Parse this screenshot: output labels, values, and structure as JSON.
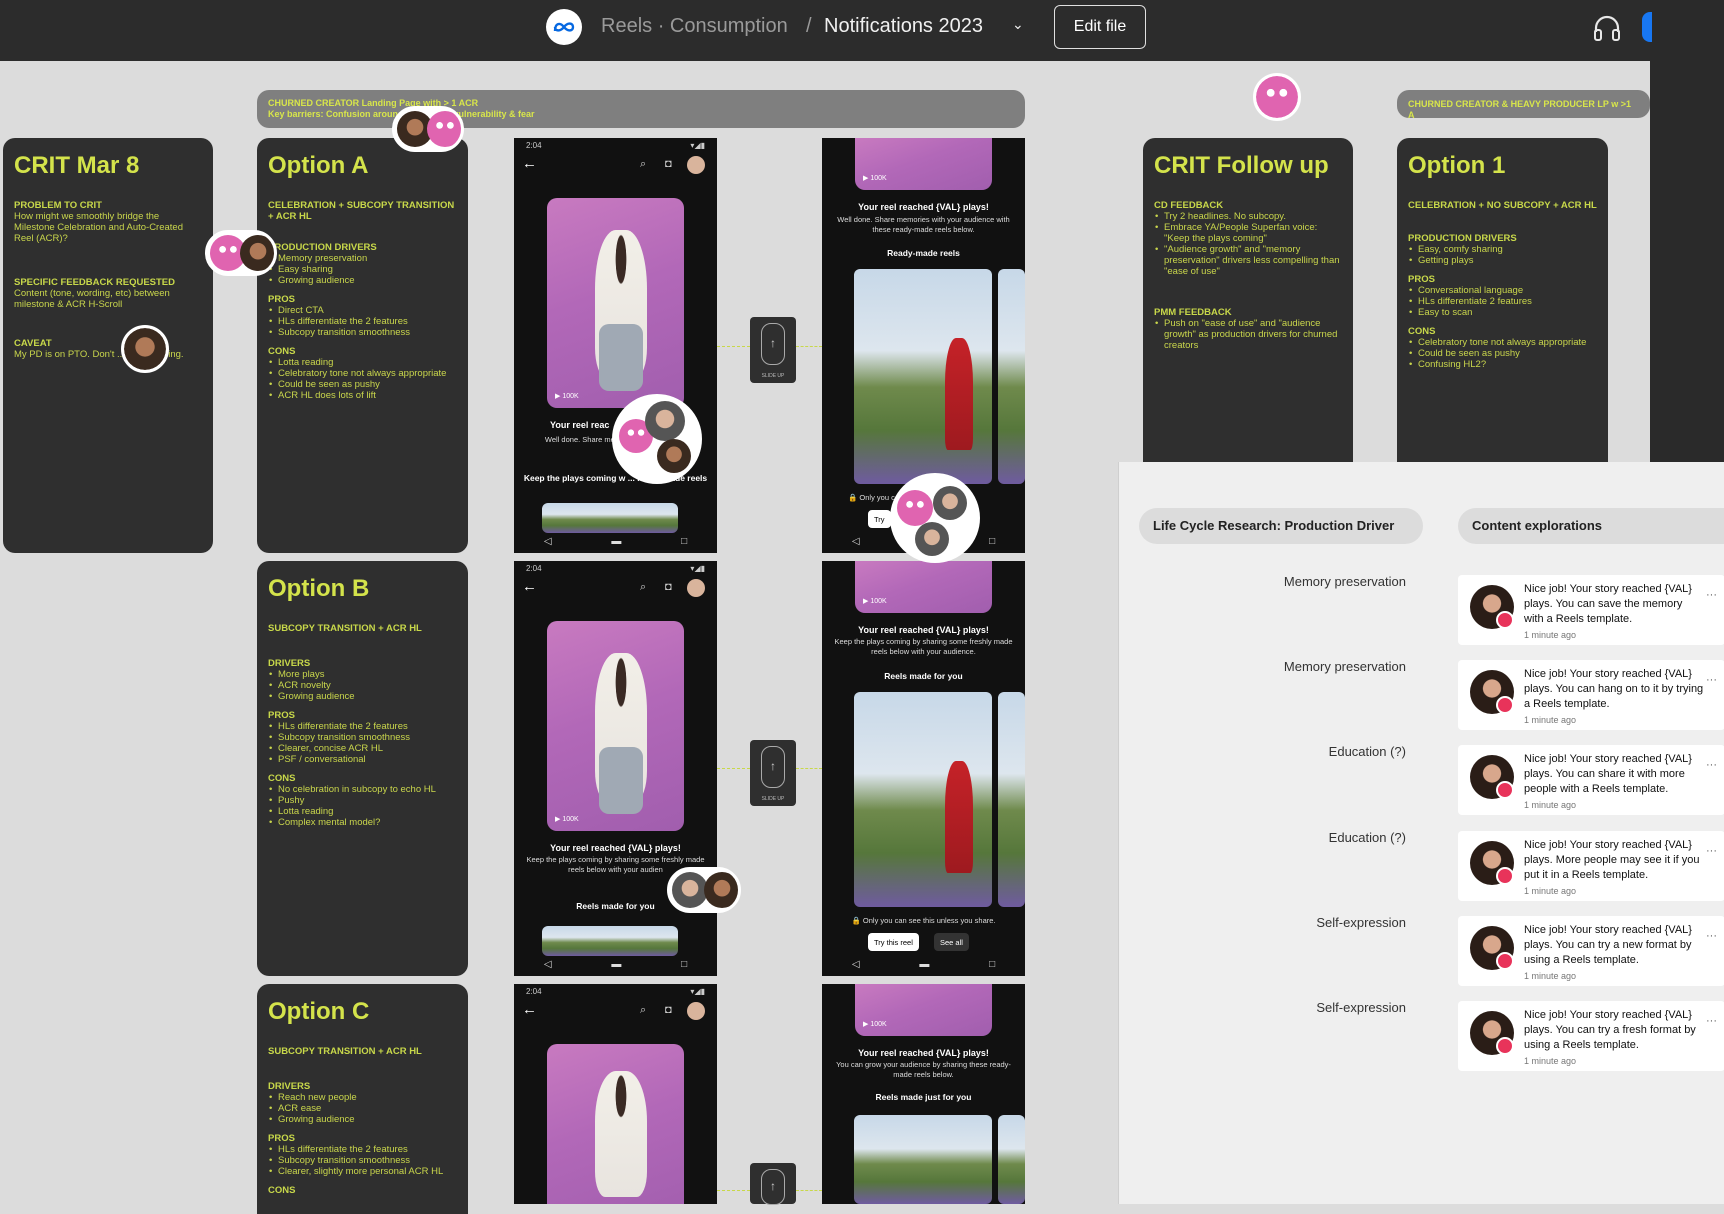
{
  "header": {
    "breadcrumb_parent": "Reels · Consumption",
    "separator": "/",
    "file_name": "Notifications 2023",
    "edit_button": "Edit file"
  },
  "banners": [
    {
      "line1": "CHURNED CREATOR Landing Page with > 1 ACR",
      "line2": "Key barriers: Confusion around the model, vulnerability & fear"
    },
    {
      "line1": "CHURNED CREATOR & HEAVY PRODUCER LP w >1 A",
      "line2": ""
    }
  ],
  "cards": {
    "crit": {
      "title": "CRIT Mar 8",
      "s1": "PROBLEM TO CRIT",
      "t1": "How might we smoothly bridge the Milestone Celebration and Auto-Created Reel (ACR)?",
      "s2": "SPECIFIC FEEDBACK REQUESTED",
      "t2": "Content (tone, wording, etc) between milestone & ACR H-Scroll",
      "s3": "CAVEAT",
      "t3": "My PD is on PTO. Don't ... : my spacing."
    },
    "optA": {
      "title": "Option A",
      "subtitle": "CELEBRATION + SUBCOPY TRANSITION + ACR HL",
      "drivers_h": "PRODUCTION DRIVERS",
      "drivers": [
        "Memory preservation",
        "Easy sharing",
        "Growing audience"
      ],
      "pros_h": "PROS",
      "pros": [
        "Direct CTA",
        "HLs differentiate the 2 features",
        "Subcopy transition smoothness"
      ],
      "cons_h": "CONS",
      "cons": [
        "Lotta reading",
        "Celebratory tone not always appropriate",
        "Could be seen as pushy",
        "ACR HL does lots of lift"
      ]
    },
    "optB": {
      "title": "Option B",
      "subtitle": "SUBCOPY TRANSITION + ACR HL",
      "drivers_h": "DRIVERS",
      "drivers": [
        "More plays",
        "ACR novelty",
        "Growing audience"
      ],
      "pros_h": "PROS",
      "pros": [
        "HLs differentiate the 2 features",
        "Subcopy transition smoothness",
        "Clearer, concise ACR HL",
        "PSF / conversational"
      ],
      "cons_h": "CONS",
      "cons": [
        "No celebration in subcopy to echo HL",
        "Pushy",
        "Lotta reading",
        "Complex mental model?"
      ]
    },
    "optC": {
      "title": "Option C",
      "subtitle": "SUBCOPY TRANSITION + ACR HL",
      "drivers_h": "DRIVERS",
      "drivers": [
        "Reach new people",
        "ACR ease",
        "Growing audience"
      ],
      "pros_h": "PROS",
      "pros": [
        "HLs differentiate the 2 features",
        "Subcopy transition smoothness",
        "Clearer, slightly more personal ACR HL"
      ],
      "cons_h": "CONS"
    },
    "followup": {
      "title": "CRIT Follow up",
      "cd_h": "CD FEEDBACK",
      "cd": [
        "Try 2 headlines. No subcopy.",
        "Embrace YA/People Superfan voice: \"Keep the plays coming\"",
        "\"Audience growth\" and \"memory preservation\" drivers less compelling than \"ease of use\""
      ],
      "pmm_h": "PMM FEEDBACK",
      "pmm": [
        "Push on \"ease of use\" and \"audience growth\" as production drivers for churned creators"
      ]
    },
    "opt1": {
      "title": "Option 1",
      "subtitle": "CELEBRATION + NO SUBCOPY + ACR HL",
      "drivers_h": "PRODUCTION DRIVERS",
      "drivers": [
        "Easy, comfy sharing",
        "Getting plays"
      ],
      "pros_h": "PROS",
      "pros": [
        "Conversational language",
        "HLs differentiate 2 features",
        "Easy to scan"
      ],
      "cons_h": "CONS",
      "cons": [
        "Celebratory tone not always appropriate",
        "Could be seen as pushy",
        "Confusing HL2?"
      ]
    }
  },
  "phones": {
    "time": "2:04",
    "views": "▶ 100K",
    "slide_up": "SLIDE UP",
    "a_left_caption": "Your reel reac",
    "a_left_sub": "Well done. Share mem ... with these ready",
    "a_left_bottom": "Keep the plays coming w ... ready-made reels",
    "a_right_caption": "Your reel reached {VAL} plays!",
    "a_right_sub": "Well done. Share memories with your audience with these ready-made reels below.",
    "a_right_section": "Ready-made reels",
    "a_right_lock": "🔒 Only you c ... share.",
    "a_right_try": "Try",
    "b_left_caption": "Your reel reached {VAL} plays!",
    "b_left_sub": "Keep the plays coming by sharing some freshly made reels below with your audien",
    "b_left_section": "Reels made for you",
    "b_right_caption": "Your reel reached {VAL} plays!",
    "b_right_sub": "Keep the plays coming by sharing some freshly made reels below with your audience.",
    "b_right_section": "Reels made for you",
    "b_right_lock": "🔒 Only you can see this unless you share.",
    "b_right_try": "Try this reel",
    "b_right_see": "See all",
    "c_right_caption": "Your reel reached {VAL} plays!",
    "c_right_sub": "You can grow your audience by sharing these ready-made reels below.",
    "c_right_section": "Reels made just for you"
  },
  "panel": {
    "tag_left": "Life Cycle Research: Production Driver",
    "tag_right": "Content explorations",
    "rows": [
      {
        "label": "Memory preservation",
        "text": "Nice job! Your story reached {VAL} plays. You can save the memory with a Reels template.",
        "time": "1 minute ago"
      },
      {
        "label": "Memory preservation",
        "text": "Nice job! Your story reached {VAL} plays. You can hang on to it by trying a Reels template.",
        "time": "1 minute ago"
      },
      {
        "label": "Education (?)",
        "text": "Nice job! Your story reached {VAL} plays. You can share it with more people with a Reels template.",
        "time": "1 minute ago"
      },
      {
        "label": "Education (?)",
        "text": "Nice job! Your story reached {VAL} plays. More people may see it if you put it in a Reels template.",
        "time": "1 minute ago"
      },
      {
        "label": "Self-expression",
        "text": "Nice job! Your story reached {VAL} plays. You can try a new format by using a Reels template.",
        "time": "1 minute ago"
      },
      {
        "label": "Self-expression",
        "text": "Nice job! Your story reached {VAL} plays. You can try a fresh format by using a Reels template.",
        "time": "1 minute ago"
      }
    ],
    "dots": "···"
  },
  "colors": {
    "accent": "#d4e34b",
    "card": "#2f2f2f",
    "topbar": "#2c2c2c",
    "badge": "#e8335a"
  }
}
